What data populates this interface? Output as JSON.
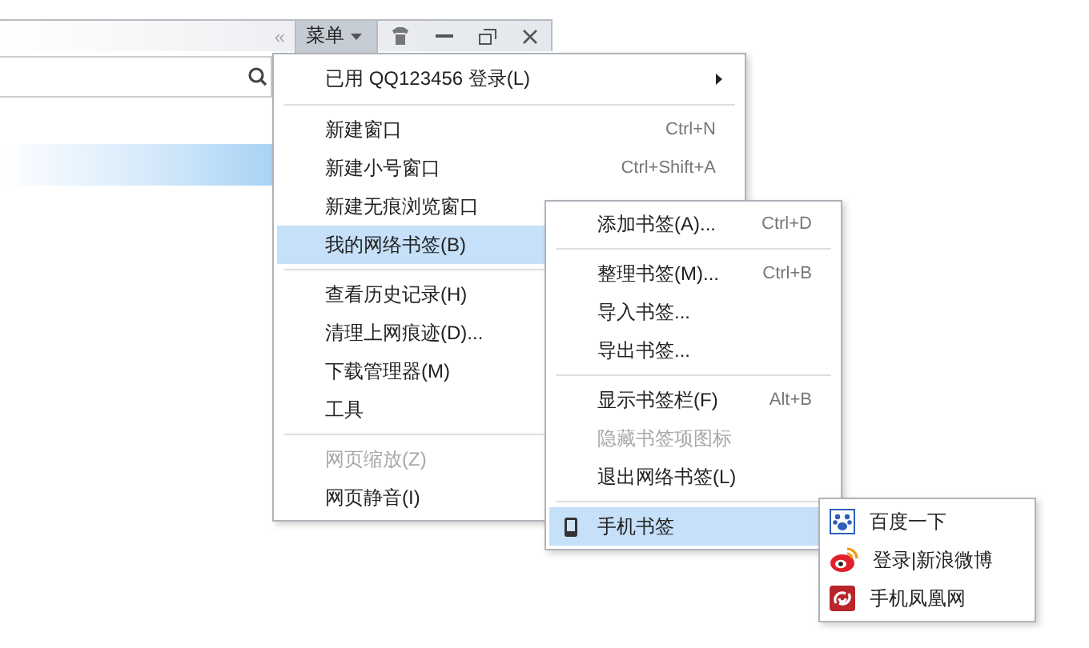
{
  "toolbar": {
    "collapse_glyph": "«",
    "menu_button": {
      "label": "菜单",
      "open": true
    }
  },
  "menu": {
    "groups": [
      [
        {
          "label": "已用 QQ123456 登录(L)",
          "disabled": false,
          "selected": false,
          "kind": "submenu"
        }
      ],
      [
        {
          "label": "新建窗口",
          "shortcut": "Ctrl+N",
          "disabled": false,
          "selected": false,
          "kind": "plain"
        },
        {
          "label": "新建小号窗口",
          "shortcut": "Ctrl+Shift+A",
          "disabled": false,
          "selected": false,
          "kind": "plain"
        },
        {
          "label": "新建无痕浏览窗口",
          "disabled": false,
          "selected": false,
          "kind": "plain"
        },
        {
          "label": "我的网络书签(B)",
          "disabled": false,
          "selected": true,
          "kind": "plain"
        }
      ],
      [
        {
          "label": "查看历史记录(H)",
          "disabled": false,
          "selected": false,
          "kind": "plain"
        },
        {
          "label": "清理上网痕迹(D)...",
          "disabled": false,
          "selected": false,
          "kind": "plain"
        },
        {
          "label": "下载管理器(M)",
          "disabled": false,
          "selected": false,
          "kind": "plain"
        },
        {
          "label": "工具",
          "disabled": false,
          "selected": false,
          "kind": "plain"
        }
      ],
      [
        {
          "label": "网页缩放(Z)",
          "disabled": true,
          "selected": false,
          "kind": "plain"
        },
        {
          "label": "网页静音(I)",
          "disabled": false,
          "selected": false,
          "kind": "plain"
        }
      ]
    ]
  },
  "bookmarks_menu": {
    "groups": [
      [
        {
          "label": "添加书签(A)...",
          "shortcut": "Ctrl+D",
          "disabled": false,
          "selected": false,
          "kind": "plain"
        }
      ],
      [
        {
          "label": "整理书签(M)...",
          "shortcut": "Ctrl+B",
          "disabled": false,
          "selected": false,
          "kind": "plain"
        },
        {
          "label": "导入书签...",
          "disabled": false,
          "selected": false,
          "kind": "plain"
        },
        {
          "label": "导出书签...",
          "disabled": false,
          "selected": false,
          "kind": "plain"
        }
      ],
      [
        {
          "label": "显示书签栏(F)",
          "shortcut": "Alt+B",
          "disabled": false,
          "selected": false,
          "kind": "plain"
        },
        {
          "label": "隐藏书签项图标",
          "disabled": true,
          "selected": false,
          "kind": "plain"
        },
        {
          "label": "退出网络书签(L)",
          "disabled": false,
          "selected": false,
          "kind": "plain"
        }
      ],
      [
        {
          "label": "手机书签",
          "disabled": false,
          "selected": true,
          "kind": "device"
        }
      ]
    ]
  },
  "mobile_bookmarks": [
    {
      "label": "百度一下"
    },
    {
      "label": "登录|新浪微博"
    },
    {
      "label": "手机凤凰网"
    }
  ]
}
